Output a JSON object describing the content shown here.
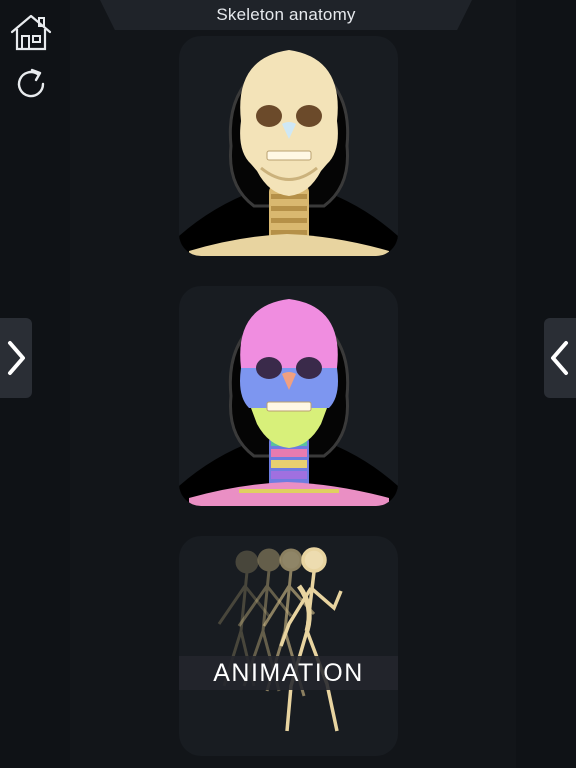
{
  "header": {
    "title": "Skeleton anatomy"
  },
  "toolbar": {
    "home_icon": "home-icon",
    "refresh_icon": "refresh-icon"
  },
  "navigation": {
    "left_arrow_icon": "chevron-right-icon",
    "right_arrow_icon": "chevron-left-icon"
  },
  "cards": [
    {
      "name": "realistic-skeleton"
    },
    {
      "name": "colored-skeleton"
    },
    {
      "name": "animation",
      "label": "ANIMATION"
    }
  ],
  "colors": {
    "background": "#121519",
    "card_background": "#181c21",
    "bone": "#eddcb0",
    "accent_pink": "#f08de0",
    "accent_yellow": "#d8f07a",
    "accent_blue": "#7d96f0"
  }
}
